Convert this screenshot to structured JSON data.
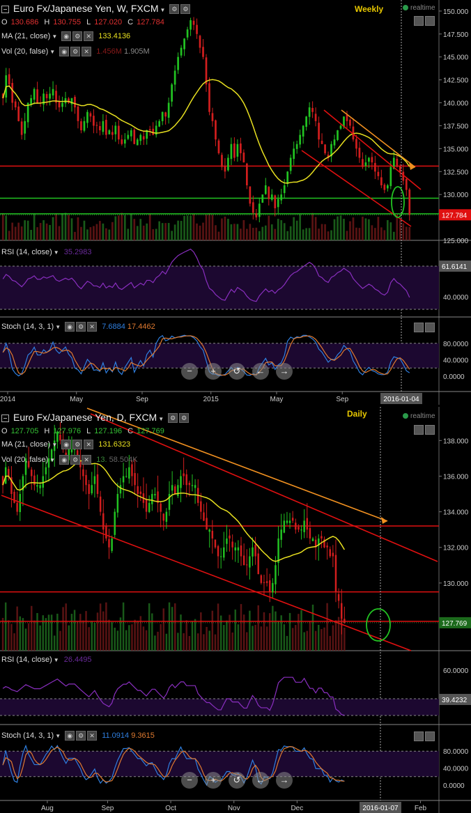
{
  "weekly": {
    "title": "Euro Fx/Japanese Yen, W, FXCM",
    "ohlc": {
      "O": "130.686",
      "H": "130.755",
      "L": "127.020",
      "C": "127.784"
    },
    "ma_label": "MA (21, close)",
    "ma_value": "133.4136",
    "vol_label": "Vol (20, false)",
    "vol_values": [
      "1.456M",
      "1.905M"
    ],
    "tag": "Weekly",
    "realtime": "realtime",
    "rsi_label": "RSI (14, close)",
    "rsi_value": "35.2983",
    "stoch_label": "Stoch (14, 3, 1)",
    "stoch_k": "7.6884",
    "stoch_d": "17.4462",
    "price_badge": "127.784",
    "rsi_badge": "61.6141",
    "date_badge": "2016-01-04",
    "x_labels": [
      "2014",
      "May",
      "Sep",
      "2015",
      "May",
      "Sep"
    ],
    "nav": [
      "−",
      "+",
      "↺",
      "←",
      "→"
    ]
  },
  "daily": {
    "title": "Euro Fx/Japanese Yen, D, FXCM",
    "ohlc": {
      "O": "127.705",
      "H": "127.976",
      "L": "127.196",
      "C": "127.769"
    },
    "ma_label": "MA (21, close)",
    "ma_value": "131.6323",
    "vol_label": "Vol (20, false)",
    "vol_values": [
      "13.",
      "58.504K"
    ],
    "tag": "Daily",
    "realtime": "realtime",
    "rsi_label": "RSI (14, close)",
    "rsi_value": "26.4495",
    "stoch_label": "Stoch (14, 3, 1)",
    "stoch_k": "11.0914",
    "stoch_d": "9.3615",
    "price_badge": "127.769",
    "rsi_badge": "39.4232",
    "date_badge": "2016-01-07",
    "x_labels": [
      "Aug",
      "Sep",
      "Oct",
      "Nov",
      "Dec",
      "Feb"
    ],
    "nav": [
      "−",
      "+",
      "↺",
      "←",
      "→"
    ]
  },
  "colors": {
    "bull": "#22c322",
    "bear": "#d21e1e",
    "ma": "#e8e020",
    "rsi": "#8a2fc0",
    "stoch_k": "#2f7fe0",
    "stoch_d": "#e07a30",
    "trend_red": "#e01010",
    "trend_orange": "#f09020",
    "support_green": "#22c322",
    "pane_bg": "#1c0830"
  },
  "chart_data": [
    {
      "type": "candlestick",
      "title": "Euro Fx/Japanese Yen, W, FXCM",
      "timeframe": "W",
      "y_axis_ticks": [
        150.0,
        147.5,
        145.0,
        142.5,
        140.0,
        137.5,
        135.0,
        132.5,
        130.0,
        127.5,
        125.0
      ],
      "ylim": [
        125,
        150.6
      ],
      "x_labels": [
        "2014",
        "May",
        "Sep",
        "2015",
        "May",
        "Sep"
      ],
      "x_label_bar_index": [
        2,
        24,
        45,
        67,
        88,
        109
      ],
      "total_bars": 131,
      "close_path": [
        140.5,
        143,
        142,
        140,
        139.5,
        138,
        136.5,
        138,
        140,
        140.5,
        141.5,
        140,
        140,
        141,
        140.5,
        141,
        141.5,
        140,
        139.5,
        140,
        140.5,
        140,
        140.5,
        139.5,
        138,
        137,
        138,
        139,
        138.5,
        137.5,
        137.5,
        137,
        138,
        136.5,
        137,
        136.5,
        137.5,
        136,
        135.5,
        136,
        136.5,
        137,
        135.5,
        136,
        136.5,
        136,
        137,
        137,
        136.5,
        137.5,
        138,
        139,
        138.5,
        140,
        142,
        143.5,
        145,
        146,
        147,
        148,
        149,
        148.5,
        147.5,
        146,
        145,
        142,
        139,
        138,
        136,
        134.5,
        133,
        132.5,
        134,
        135.5,
        134,
        135.5,
        134.5,
        133.5,
        131,
        129,
        128,
        127.5,
        129,
        130,
        131,
        129.5,
        130,
        128.5,
        129.5,
        130,
        131,
        132.5,
        134,
        135,
        135.5,
        136.5,
        137.5,
        138.5,
        139.5,
        139,
        138,
        136,
        135.5,
        134.5,
        134,
        135.5,
        136,
        137,
        137.5,
        138.5,
        138,
        137.5,
        136,
        135,
        134,
        133,
        133.5,
        134,
        133.5,
        132.5,
        132,
        131,
        130.5,
        131,
        133,
        134,
        133,
        132.5,
        131.5,
        130.5,
        127.78
      ],
      "ma21": {
        "name": "MA (21, close)",
        "last": 133.4136
      },
      "horizontal_levels": [
        {
          "price": 133.1,
          "color": "red"
        },
        {
          "price": 129.6,
          "color": "green"
        },
        {
          "price": 127.9,
          "color": "green"
        }
      ],
      "last_price": 127.784,
      "rsi": {
        "name": "RSI (14, close)",
        "last": 35.2983,
        "ticks": [
          40.0
        ],
        "badge": 61.6141
      },
      "stoch": {
        "name": "Stoch (14, 3, 1)",
        "k": 7.6884,
        "d": 17.4462,
        "ticks": [
          80.0,
          40.0,
          0.0
        ]
      }
    },
    {
      "type": "candlestick",
      "title": "Euro Fx/Japanese Yen, D, FXCM",
      "timeframe": "D",
      "y_axis_ticks": [
        138.0,
        136.0,
        134.0,
        132.0,
        130.0
      ],
      "ylim": [
        126.2,
        139.5
      ],
      "x_labels": [
        "Aug",
        "Sep",
        "Oct",
        "Nov",
        "Dec",
        "Feb"
      ],
      "x_label_bar_index": [
        16,
        37,
        59,
        81,
        103,
        146
      ],
      "total_bars": 150,
      "close_path": [
        135.5,
        136.5,
        136,
        135,
        134.5,
        134,
        135,
        136,
        137,
        136.5,
        136,
        135.5,
        135.5,
        135.5,
        136,
        136.5,
        137,
        137.5,
        138,
        138.5,
        138,
        137.5,
        137,
        137.5,
        137.5,
        137.5,
        137,
        136.5,
        136,
        135.5,
        135,
        135.5,
        136,
        135,
        134,
        133,
        132.5,
        132,
        132.5,
        134,
        135,
        135.5,
        136,
        136,
        136.5,
        136,
        135.5,
        135,
        135,
        134.5,
        134,
        134.5,
        135,
        135,
        134.5,
        134,
        133.5,
        134,
        135,
        135.5,
        135,
        135.5,
        136,
        136,
        135.5,
        135.5,
        135.5,
        135.5,
        134.5,
        134,
        133.5,
        133,
        133,
        132.5,
        132,
        131.5,
        131.5,
        132,
        132.5,
        132.5,
        132,
        132,
        132,
        131.5,
        131,
        131,
        131.5,
        132,
        131.5,
        130.5,
        130,
        130,
        130,
        129.5,
        130,
        131,
        132.5,
        133,
        133.5,
        133.5,
        133.5,
        133.5,
        133,
        133,
        133,
        133.5,
        133,
        132.5,
        132.5,
        132,
        132.5,
        132.5,
        132,
        132,
        131.5,
        131.5,
        129.5,
        129,
        128,
        127.77
      ],
      "ma21": {
        "name": "MA (21, close)",
        "last": 131.6323
      },
      "horizontal_levels": [
        {
          "price": 133.2,
          "color": "red"
        },
        {
          "price": 129.5,
          "color": "red"
        },
        {
          "price": 127.85,
          "color": "red"
        }
      ],
      "last_price": 127.769,
      "rsi": {
        "name": "RSI (14, close)",
        "last": 26.4495,
        "ticks": [
          60.0
        ],
        "badge": 39.4232
      },
      "stoch": {
        "name": "Stoch (14, 3, 1)",
        "k": 11.0914,
        "d": 9.3615,
        "ticks": [
          80.0,
          40.0,
          0.0
        ]
      }
    }
  ]
}
